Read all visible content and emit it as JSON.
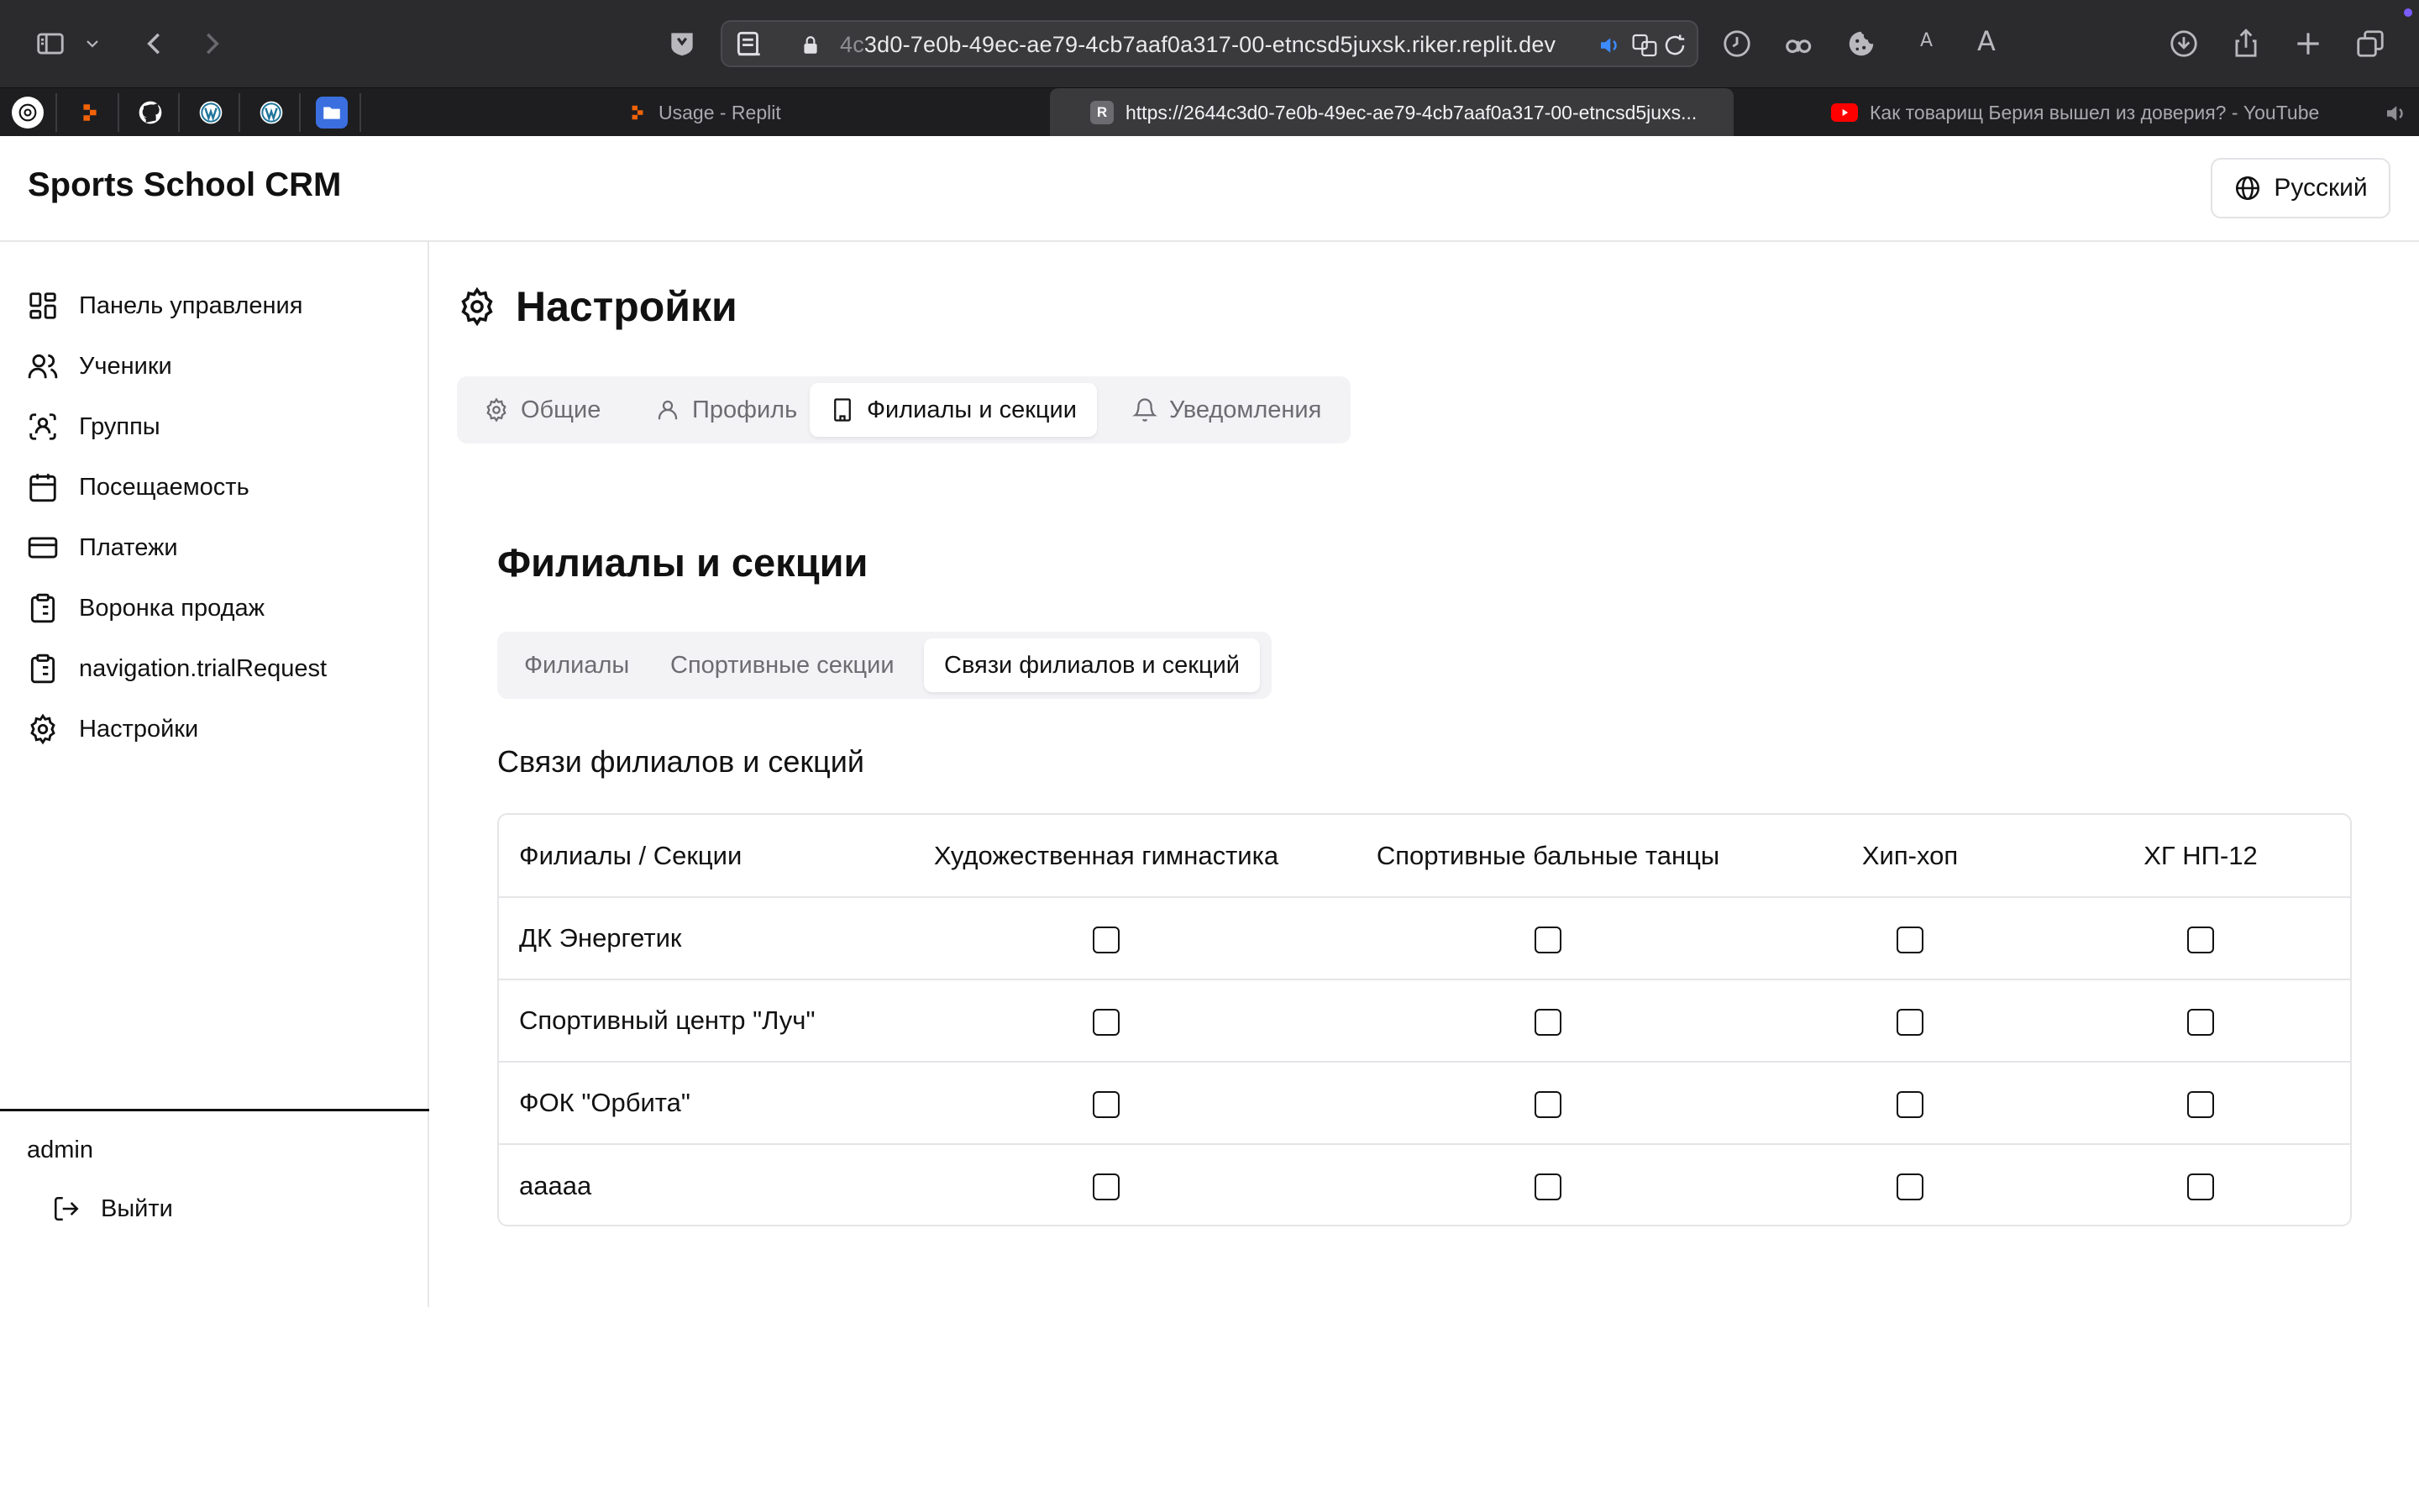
{
  "browser": {
    "url_prefix": "4c",
    "url_rest": "3d0-7e0b-49ec-ae79-4cb7aaf0a317-00-etncsd5juxsk.riker.replit.dev",
    "ext_label_small": "A",
    "ext_label_large": "A",
    "tabs": [
      {
        "title": "Usage - Replit",
        "active": false
      },
      {
        "title": "https://2644c3d0-7e0b-49ec-ae79-4cb7aaf0a317-00-etncsd5juxs...",
        "active": true
      },
      {
        "title": "Как товарищ Берия вышел из доверия? - YouTube",
        "active": false
      }
    ],
    "tab_favicon_letter": "R"
  },
  "app": {
    "brand": "Sports School CRM",
    "language": "Русский"
  },
  "sidebar": {
    "items": [
      {
        "label": "Панель управления",
        "icon": "dashboard-icon"
      },
      {
        "label": "Ученики",
        "icon": "users-icon"
      },
      {
        "label": "Группы",
        "icon": "groups-icon"
      },
      {
        "label": "Посещаемость",
        "icon": "calendar-icon"
      },
      {
        "label": "Платежи",
        "icon": "credit-card-icon"
      },
      {
        "label": "Воронка продаж",
        "icon": "clipboard-icon"
      },
      {
        "label": "navigation.trialRequest",
        "icon": "clipboard-icon"
      },
      {
        "label": "Настройки",
        "icon": "gear-icon"
      }
    ],
    "user": "admin",
    "logout": "Выйти"
  },
  "page": {
    "title": "Настройки",
    "tabs": [
      {
        "label": "Общие",
        "icon": "gear-icon"
      },
      {
        "label": "Профиль",
        "icon": "user-icon"
      },
      {
        "label": "Филиалы и секции",
        "icon": "building-icon",
        "active": true
      },
      {
        "label": "Уведомления",
        "icon": "bell-icon"
      }
    ],
    "section_title": "Филиалы и секции",
    "subtabs": [
      {
        "label": "Филиалы"
      },
      {
        "label": "Спортивные секции"
      },
      {
        "label": "Связи филиалов и секций",
        "active": true
      }
    ],
    "matrix_title": "Связи филиалов и секций",
    "matrix": {
      "corner": "Филиалы / Секции",
      "columns": [
        "Художественная гимнастика",
        "Спортивные бальные танцы",
        "Хип-хоп",
        "ХГ НП-12"
      ],
      "rows": [
        {
          "branch": "ДК Энергетик",
          "checked": [
            false,
            false,
            false,
            false
          ]
        },
        {
          "branch": "Спортивный центр \"Луч\"",
          "checked": [
            false,
            false,
            false,
            false
          ]
        },
        {
          "branch": "ФОК \"Орбита\"",
          "checked": [
            false,
            false,
            false,
            false
          ]
        },
        {
          "branch": "ааааа",
          "checked": [
            false,
            false,
            false,
            false
          ]
        }
      ]
    }
  }
}
